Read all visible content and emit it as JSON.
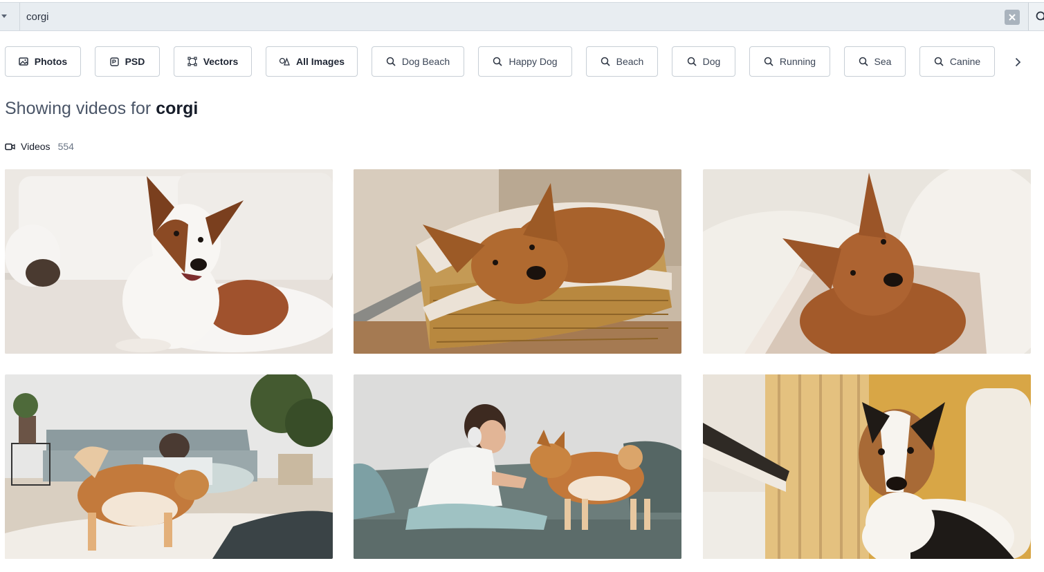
{
  "search": {
    "value": "corgi",
    "placeholder": ""
  },
  "filters": [
    {
      "label": "Photos",
      "icon": "photo-icon"
    },
    {
      "label": "PSD",
      "icon": "psd-icon"
    },
    {
      "label": "Vectors",
      "icon": "vector-icon"
    },
    {
      "label": "All Images",
      "icon": "all-images-icon"
    }
  ],
  "related_searches": [
    {
      "label": "Dog Beach",
      "icon": "search-icon"
    },
    {
      "label": "Happy Dog",
      "icon": "search-icon"
    },
    {
      "label": "Beach",
      "icon": "search-icon"
    },
    {
      "label": "Dog",
      "icon": "search-icon"
    },
    {
      "label": "Running",
      "icon": "search-icon"
    },
    {
      "label": "Sea",
      "icon": "search-icon"
    },
    {
      "label": "Canine",
      "icon": "search-icon"
    }
  ],
  "heading": {
    "prefix": "Showing videos for",
    "query": "corgi"
  },
  "results_tab": {
    "label": "Videos",
    "count": "554",
    "icon": "video-camera-icon"
  },
  "colors": {
    "chip_border": "#c7ced5",
    "search_bg": "#e8edf1",
    "heading_muted": "#4a5567",
    "heading_strong": "#161c29"
  }
}
